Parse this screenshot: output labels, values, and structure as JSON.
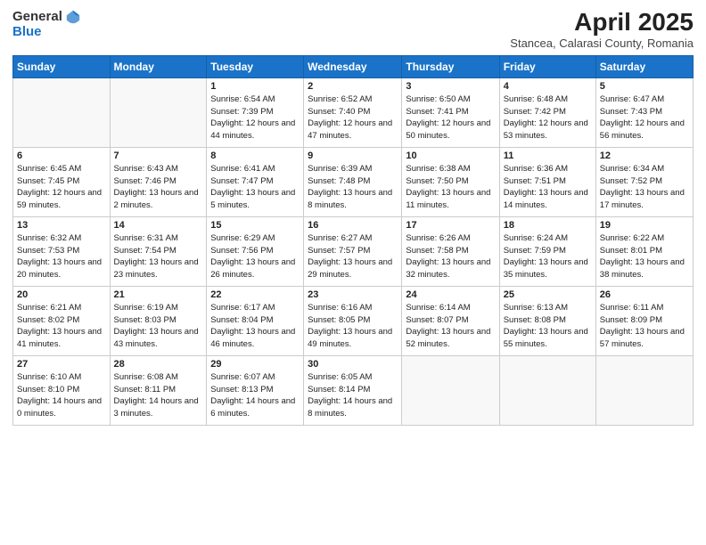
{
  "header": {
    "logo_general": "General",
    "logo_blue": "Blue",
    "month": "April 2025",
    "location": "Stancea, Calarasi County, Romania"
  },
  "weekdays": [
    "Sunday",
    "Monday",
    "Tuesday",
    "Wednesday",
    "Thursday",
    "Friday",
    "Saturday"
  ],
  "weeks": [
    [
      {
        "day": "",
        "sunrise": "",
        "sunset": "",
        "daylight": ""
      },
      {
        "day": "",
        "sunrise": "",
        "sunset": "",
        "daylight": ""
      },
      {
        "day": "1",
        "sunrise": "Sunrise: 6:54 AM",
        "sunset": "Sunset: 7:39 PM",
        "daylight": "Daylight: 12 hours and 44 minutes."
      },
      {
        "day": "2",
        "sunrise": "Sunrise: 6:52 AM",
        "sunset": "Sunset: 7:40 PM",
        "daylight": "Daylight: 12 hours and 47 minutes."
      },
      {
        "day": "3",
        "sunrise": "Sunrise: 6:50 AM",
        "sunset": "Sunset: 7:41 PM",
        "daylight": "Daylight: 12 hours and 50 minutes."
      },
      {
        "day": "4",
        "sunrise": "Sunrise: 6:48 AM",
        "sunset": "Sunset: 7:42 PM",
        "daylight": "Daylight: 12 hours and 53 minutes."
      },
      {
        "day": "5",
        "sunrise": "Sunrise: 6:47 AM",
        "sunset": "Sunset: 7:43 PM",
        "daylight": "Daylight: 12 hours and 56 minutes."
      }
    ],
    [
      {
        "day": "6",
        "sunrise": "Sunrise: 6:45 AM",
        "sunset": "Sunset: 7:45 PM",
        "daylight": "Daylight: 12 hours and 59 minutes."
      },
      {
        "day": "7",
        "sunrise": "Sunrise: 6:43 AM",
        "sunset": "Sunset: 7:46 PM",
        "daylight": "Daylight: 13 hours and 2 minutes."
      },
      {
        "day": "8",
        "sunrise": "Sunrise: 6:41 AM",
        "sunset": "Sunset: 7:47 PM",
        "daylight": "Daylight: 13 hours and 5 minutes."
      },
      {
        "day": "9",
        "sunrise": "Sunrise: 6:39 AM",
        "sunset": "Sunset: 7:48 PM",
        "daylight": "Daylight: 13 hours and 8 minutes."
      },
      {
        "day": "10",
        "sunrise": "Sunrise: 6:38 AM",
        "sunset": "Sunset: 7:50 PM",
        "daylight": "Daylight: 13 hours and 11 minutes."
      },
      {
        "day": "11",
        "sunrise": "Sunrise: 6:36 AM",
        "sunset": "Sunset: 7:51 PM",
        "daylight": "Daylight: 13 hours and 14 minutes."
      },
      {
        "day": "12",
        "sunrise": "Sunrise: 6:34 AM",
        "sunset": "Sunset: 7:52 PM",
        "daylight": "Daylight: 13 hours and 17 minutes."
      }
    ],
    [
      {
        "day": "13",
        "sunrise": "Sunrise: 6:32 AM",
        "sunset": "Sunset: 7:53 PM",
        "daylight": "Daylight: 13 hours and 20 minutes."
      },
      {
        "day": "14",
        "sunrise": "Sunrise: 6:31 AM",
        "sunset": "Sunset: 7:54 PM",
        "daylight": "Daylight: 13 hours and 23 minutes."
      },
      {
        "day": "15",
        "sunrise": "Sunrise: 6:29 AM",
        "sunset": "Sunset: 7:56 PM",
        "daylight": "Daylight: 13 hours and 26 minutes."
      },
      {
        "day": "16",
        "sunrise": "Sunrise: 6:27 AM",
        "sunset": "Sunset: 7:57 PM",
        "daylight": "Daylight: 13 hours and 29 minutes."
      },
      {
        "day": "17",
        "sunrise": "Sunrise: 6:26 AM",
        "sunset": "Sunset: 7:58 PM",
        "daylight": "Daylight: 13 hours and 32 minutes."
      },
      {
        "day": "18",
        "sunrise": "Sunrise: 6:24 AM",
        "sunset": "Sunset: 7:59 PM",
        "daylight": "Daylight: 13 hours and 35 minutes."
      },
      {
        "day": "19",
        "sunrise": "Sunrise: 6:22 AM",
        "sunset": "Sunset: 8:01 PM",
        "daylight": "Daylight: 13 hours and 38 minutes."
      }
    ],
    [
      {
        "day": "20",
        "sunrise": "Sunrise: 6:21 AM",
        "sunset": "Sunset: 8:02 PM",
        "daylight": "Daylight: 13 hours and 41 minutes."
      },
      {
        "day": "21",
        "sunrise": "Sunrise: 6:19 AM",
        "sunset": "Sunset: 8:03 PM",
        "daylight": "Daylight: 13 hours and 43 minutes."
      },
      {
        "day": "22",
        "sunrise": "Sunrise: 6:17 AM",
        "sunset": "Sunset: 8:04 PM",
        "daylight": "Daylight: 13 hours and 46 minutes."
      },
      {
        "day": "23",
        "sunrise": "Sunrise: 6:16 AM",
        "sunset": "Sunset: 8:05 PM",
        "daylight": "Daylight: 13 hours and 49 minutes."
      },
      {
        "day": "24",
        "sunrise": "Sunrise: 6:14 AM",
        "sunset": "Sunset: 8:07 PM",
        "daylight": "Daylight: 13 hours and 52 minutes."
      },
      {
        "day": "25",
        "sunrise": "Sunrise: 6:13 AM",
        "sunset": "Sunset: 8:08 PM",
        "daylight": "Daylight: 13 hours and 55 minutes."
      },
      {
        "day": "26",
        "sunrise": "Sunrise: 6:11 AM",
        "sunset": "Sunset: 8:09 PM",
        "daylight": "Daylight: 13 hours and 57 minutes."
      }
    ],
    [
      {
        "day": "27",
        "sunrise": "Sunrise: 6:10 AM",
        "sunset": "Sunset: 8:10 PM",
        "daylight": "Daylight: 14 hours and 0 minutes."
      },
      {
        "day": "28",
        "sunrise": "Sunrise: 6:08 AM",
        "sunset": "Sunset: 8:11 PM",
        "daylight": "Daylight: 14 hours and 3 minutes."
      },
      {
        "day": "29",
        "sunrise": "Sunrise: 6:07 AM",
        "sunset": "Sunset: 8:13 PM",
        "daylight": "Daylight: 14 hours and 6 minutes."
      },
      {
        "day": "30",
        "sunrise": "Sunrise: 6:05 AM",
        "sunset": "Sunset: 8:14 PM",
        "daylight": "Daylight: 14 hours and 8 minutes."
      },
      {
        "day": "",
        "sunrise": "",
        "sunset": "",
        "daylight": ""
      },
      {
        "day": "",
        "sunrise": "",
        "sunset": "",
        "daylight": ""
      },
      {
        "day": "",
        "sunrise": "",
        "sunset": "",
        "daylight": ""
      }
    ]
  ]
}
